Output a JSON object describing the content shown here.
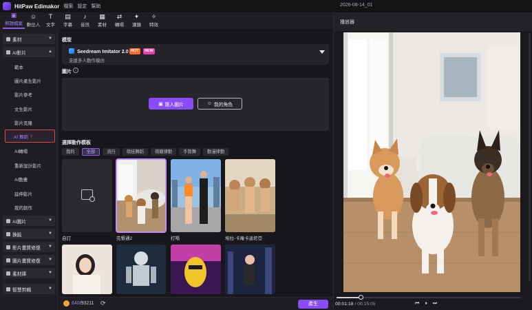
{
  "app": {
    "name": "HitPaw Edimakor",
    "menu": [
      "檔案",
      "設定",
      "幫助"
    ],
    "datestamp": "2026-08-14_01"
  },
  "toolbar": [
    {
      "label": "郵題檔案",
      "icon": "▣",
      "active": true
    },
    {
      "label": "數位人",
      "icon": "☺"
    },
    {
      "label": "文字",
      "icon": "T"
    },
    {
      "label": "字幕",
      "icon": "▤"
    },
    {
      "label": "音訊",
      "icon": "♪"
    },
    {
      "label": "素材",
      "icon": "▦"
    },
    {
      "label": "轉場",
      "icon": "⇄"
    },
    {
      "label": "濾鏡",
      "icon": "✦"
    },
    {
      "label": "特效",
      "icon": "✧"
    }
  ],
  "sidebar": {
    "groups": [
      {
        "label": "素材",
        "expanded": false
      },
      {
        "label": "AI影片",
        "expanded": true
      },
      {
        "label": "AI圖片",
        "expanded": false
      },
      {
        "label": "換臉",
        "expanded": false
      },
      {
        "label": "影片畫質修復",
        "expanded": false
      },
      {
        "label": "圖片畫質修復",
        "expanded": false
      },
      {
        "label": "素材庫",
        "expanded": false
      },
      {
        "label": "智慧剪輯",
        "expanded": false
      }
    ],
    "video_items": [
      "範本",
      "圖片產生影片",
      "影片參考",
      "文生影片",
      "影片克隆",
      "AI 舞蹈",
      "AI轉場",
      "重新設計影片",
      "AI動畫",
      "延伸影片",
      "我的創作"
    ],
    "selected": "AI 舞蹈"
  },
  "main": {
    "model_title": "模型",
    "model_name": "Seedream Imitator 2.0",
    "badge_hot": "HOT",
    "badge_new": "NEW",
    "model_desc": "支援多人動作模仿",
    "image_title": "圖片",
    "info_icon": "i",
    "import_label": "匯入圖片",
    "role_label": "我的角色",
    "template_title": "選擇動作模板",
    "tabs": [
      "我的",
      "全部",
      "流行",
      "萌娃舞蹈",
      "萌寵律動",
      "手勢舞",
      "動漫律動"
    ],
    "active_tab": "全部",
    "cards": [
      "自訂",
      "完餐通2",
      "打嗝",
      "埃拉-卡庵卡迪尼亞"
    ]
  },
  "bottom": {
    "credits_used": "640",
    "credits_total": "/93211",
    "generate": "產生"
  },
  "player": {
    "title": "播放器",
    "time_current": "00:01:18",
    "time_total": " / 00:15:05",
    "progress": 0.13,
    "controls": [
      "⏮",
      "⏸",
      "⏭"
    ]
  },
  "colors": {
    "accent": "#8a4cf6",
    "selection_outline": "#e0473e"
  }
}
